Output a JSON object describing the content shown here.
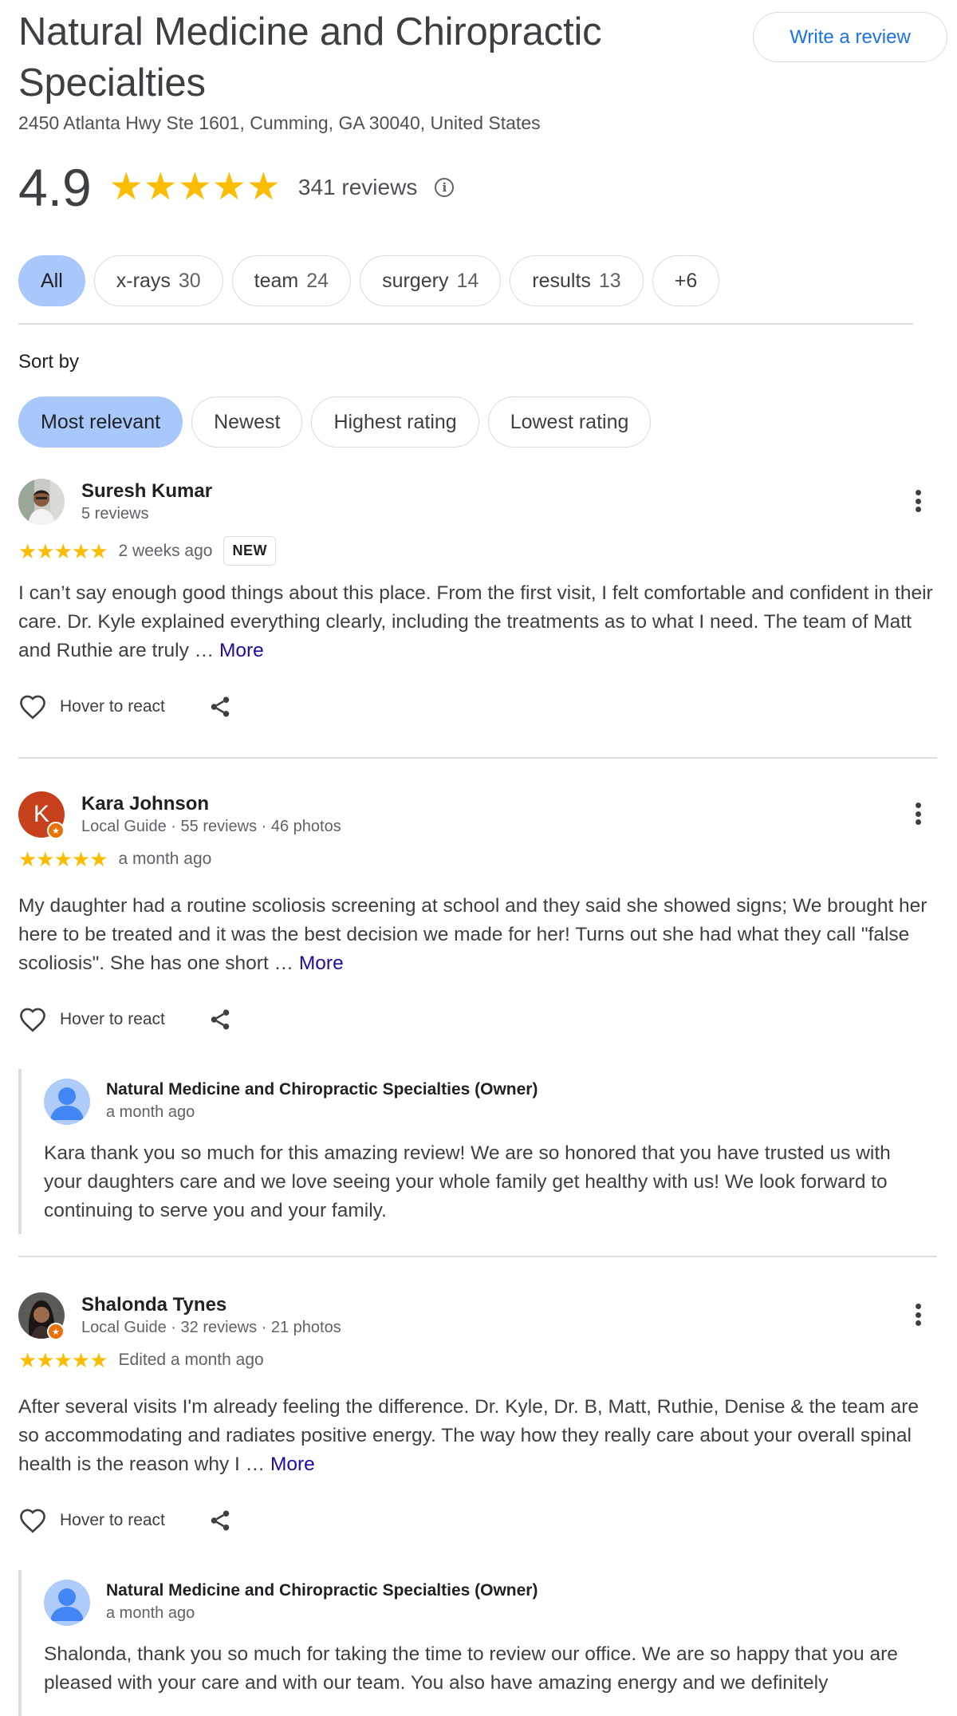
{
  "business": {
    "name": "Natural Medicine and Chiropractic Specialties",
    "address": "2450 Atlanta Hwy Ste 1601, Cumming, GA 30040, United States",
    "write_review_label": "Write a review",
    "rating": "4.9",
    "stars": "★★★★★",
    "review_count": "341 reviews"
  },
  "filters": [
    {
      "label": "All",
      "count": "",
      "selected": true
    },
    {
      "label": "x-rays",
      "count": "30"
    },
    {
      "label": "team",
      "count": "24"
    },
    {
      "label": "surgery",
      "count": "14"
    },
    {
      "label": "results",
      "count": "13"
    },
    {
      "label": "+6",
      "count": ""
    }
  ],
  "sort": {
    "label": "Sort by",
    "options": [
      "Most relevant",
      "Newest",
      "Highest rating",
      "Lowest rating"
    ],
    "selected": "Most relevant"
  },
  "reviews": [
    {
      "author": "Suresh Kumar",
      "meta": "5 reviews",
      "stars": "★★★★★",
      "when": "2 weeks ago",
      "badge": "NEW",
      "text": "I can’t say enough good things about this place. From the first visit, I felt comfortable and confident in their care. Dr. Kyle explained everything clearly, including the treatments as to what I need. The team of Matt and Ruthie are truly … ",
      "more": "More",
      "react_label": "Hover to react"
    },
    {
      "author": "Kara Johnson",
      "avatar_letter": "K",
      "avatar_color": "#c5401b",
      "meta": "Local Guide · 55 reviews · 46 photos",
      "stars": "★★★★★",
      "when": "a month ago",
      "text": "My daughter had a routine scoliosis screening at school and they said she showed signs; We brought her here to be treated and it was the best decision we made for her! Turns out she had what they call \"false scoliosis\". She has one short … ",
      "more": "More",
      "react_label": "Hover to react",
      "owner_reply": {
        "name": "Natural Medicine and Chiropractic Specialties (Owner)",
        "when": "a month ago",
        "text": "Kara thank you so much for this amazing review! We are so honored that you have trusted us with your daughters care and we love seeing your whole family get healthy with us! We look forward to continuing to serve you and your family."
      }
    },
    {
      "author": "Shalonda Tynes",
      "meta": "Local Guide · 32 reviews · 21 photos",
      "stars": "★★★★★",
      "when": "Edited a month ago",
      "text": "After several visits I'm already feeling the difference. Dr. Kyle, Dr. B, Matt, Ruthie, Denise & the team are so accommodating and radiates positive energy. The way how they really care about your overall spinal health is the reason why I … ",
      "more": "More",
      "react_label": "Hover to react",
      "owner_reply": {
        "name": "Natural Medicine and Chiropractic Specialties (Owner)",
        "when": "a month ago",
        "text": "Shalonda, thank you so much for taking the time to review our office. We are so happy that you are pleased with your care and with our team. You also have amazing energy and we definitely"
      }
    }
  ],
  "colors": {
    "star": "#fbbc04",
    "selected_chip": "#a8c7fa",
    "link": "#1a0dab",
    "accent": "#1a73e8"
  }
}
